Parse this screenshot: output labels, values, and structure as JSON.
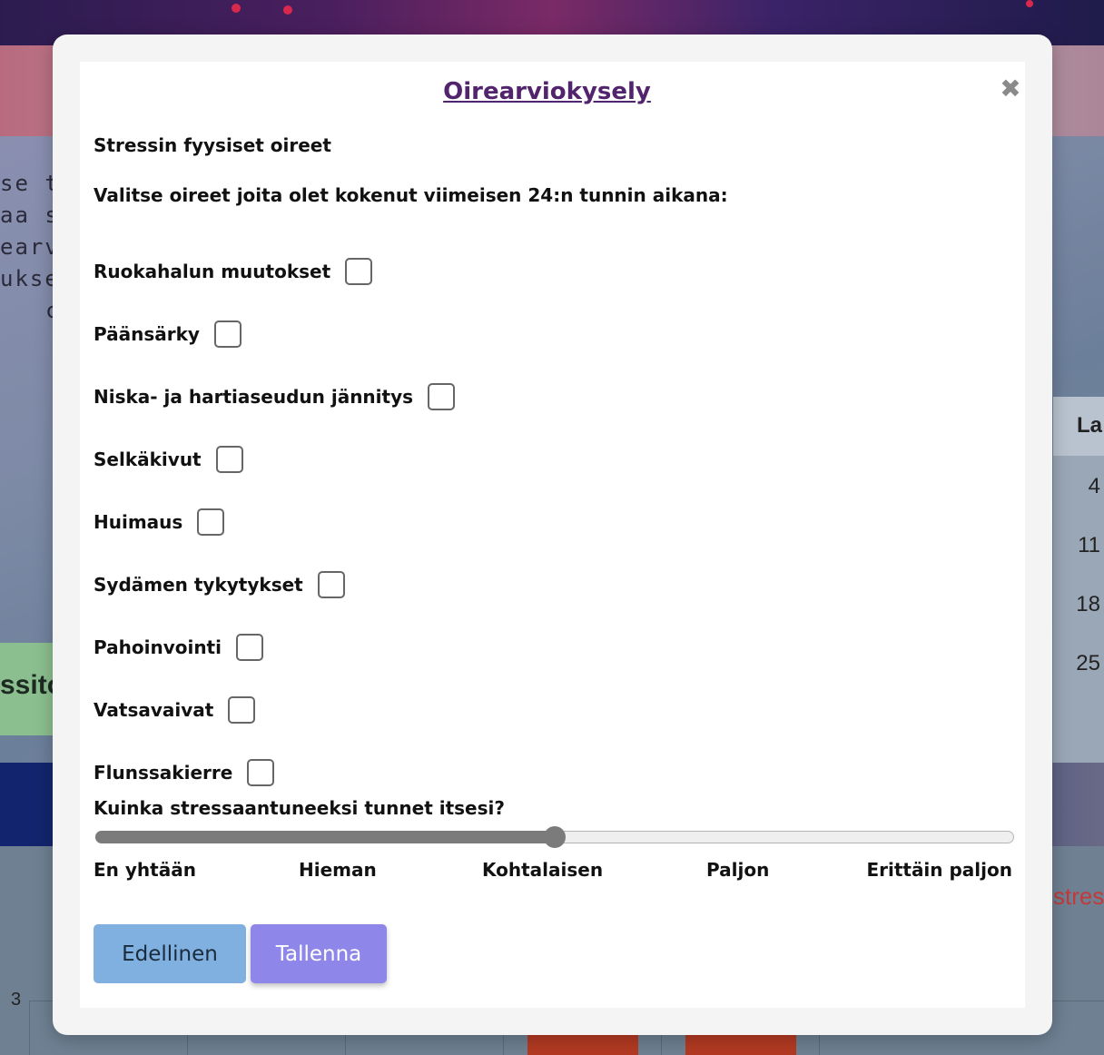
{
  "background": {
    "text_fragments": [
      "se to",
      "aa si",
      "earvi",
      "ukse",
      "c"
    ],
    "green_button_fragment": "ssito",
    "calendar": {
      "header": "La",
      "days": [
        "4",
        "11",
        "18",
        "25"
      ]
    },
    "chart": {
      "red_text_fragment": "stres",
      "y_tick": "3"
    }
  },
  "modal": {
    "title": "Oirearviokysely",
    "close_symbol": "✖",
    "section_heading": "Stressin fyysiset oireet",
    "instruction": "Valitse oireet joita olet kokenut viimeisen 24:n tunnin aikana:",
    "symptoms": [
      {
        "label": "Ruokahalun muutokset",
        "checked": false
      },
      {
        "label": "Päänsärky",
        "checked": false
      },
      {
        "label": "Niska- ja hartiaseudun jännitys",
        "checked": false
      },
      {
        "label": "Selkäkivut",
        "checked": false
      },
      {
        "label": "Huimaus",
        "checked": false
      },
      {
        "label": "Sydämen tykytykset",
        "checked": false
      },
      {
        "label": "Pahoinvointi",
        "checked": false
      },
      {
        "label": "Vatsavaivat",
        "checked": false
      },
      {
        "label": "Flunssakierre",
        "checked": false
      }
    ],
    "stress_question": "Kuinka stressaantuneeksi tunnet itsesi?",
    "stress_slider": {
      "min": 0,
      "max": 4,
      "value": 2
    },
    "scale_labels": [
      "En yhtään",
      "Hieman",
      "Kohtalaisen",
      "Paljon",
      "Erittäin paljon"
    ],
    "buttons": {
      "previous": "Edellinen",
      "save": "Tallenna"
    }
  },
  "colors": {
    "title": "#52246e",
    "previous_button": "#7fb0e0",
    "save_button": "#8f86e9",
    "slider_fill": "#7b7b7b"
  }
}
